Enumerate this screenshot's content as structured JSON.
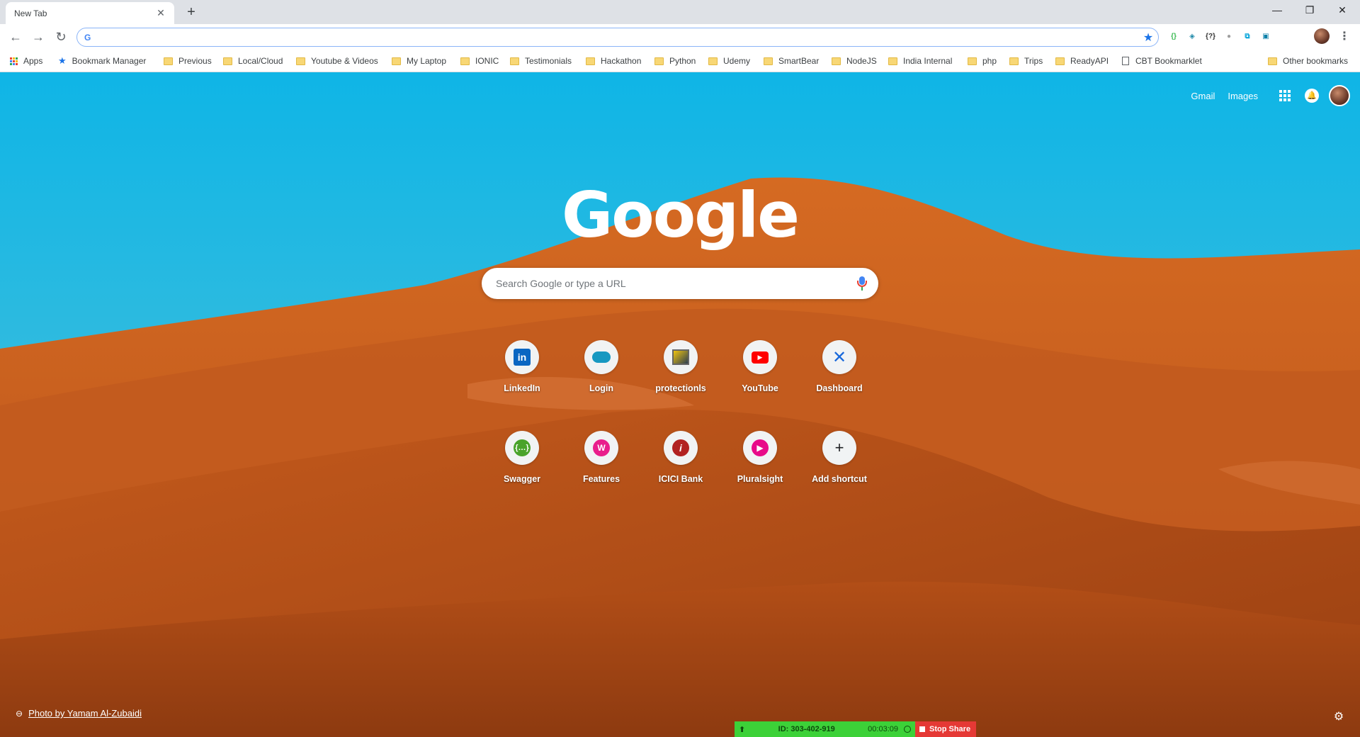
{
  "tab": {
    "title": "New Tab",
    "close": "✕",
    "new_tab": "+"
  },
  "window": {
    "minimize": "—",
    "restore": "❐",
    "close": "✕"
  },
  "toolbar": {
    "back": "←",
    "forward": "→",
    "reload": "↻",
    "omnibox_value": "",
    "omnibox_icon": "G"
  },
  "extensions": [
    {
      "icon": "json-viewer-icon",
      "glyph": "{}",
      "color": "#3cba54"
    },
    {
      "icon": "extension-teal-icon",
      "glyph": "◈",
      "color": "#1e88a8"
    },
    {
      "icon": "braces-question-icon",
      "glyph": "{?}",
      "color": "#333333"
    },
    {
      "icon": "circle-grey-icon",
      "glyph": "●",
      "color": "#9e9e9e"
    },
    {
      "icon": "capture-icon",
      "glyph": "⧉",
      "color": "#00a3d9"
    },
    {
      "icon": "screen-icon",
      "glyph": "▣",
      "color": "#0b7fa8"
    }
  ],
  "bookmarks": [
    {
      "label": "Apps",
      "type": "apps"
    },
    {
      "label": "Bookmark Manager",
      "type": "star"
    },
    {
      "label": "Previous",
      "type": "folder"
    },
    {
      "label": "Local/Cloud",
      "type": "folder"
    },
    {
      "label": "Youtube & Videos",
      "type": "folder"
    },
    {
      "label": "My Laptop",
      "type": "folder"
    },
    {
      "label": "IONIC",
      "type": "folder"
    },
    {
      "label": "Testimonials",
      "type": "folder"
    },
    {
      "label": "Hackathon",
      "type": "folder"
    },
    {
      "label": "Python",
      "type": "folder"
    },
    {
      "label": "Udemy",
      "type": "folder"
    },
    {
      "label": "SmartBear",
      "type": "folder"
    },
    {
      "label": "NodeJS",
      "type": "folder"
    },
    {
      "label": "India Internal",
      "type": "folder"
    },
    {
      "label": "php",
      "type": "folder"
    },
    {
      "label": "Trips",
      "type": "folder"
    },
    {
      "label": "ReadyAPI",
      "type": "folder"
    },
    {
      "label": "CBT Bookmarklet",
      "type": "page"
    }
  ],
  "other_bookmarks": "Other bookmarks",
  "ntp": {
    "gmail": "Gmail",
    "images": "Images",
    "logo": "Google",
    "search_placeholder": "Search Google or type a URL",
    "shortcuts": [
      {
        "label": "LinkedIn",
        "icon": "linkedin-icon",
        "glyph": "in"
      },
      {
        "label": "Login",
        "icon": "salesforce-cloud-icon",
        "glyph": ""
      },
      {
        "label": "protectionls",
        "icon": "image-thumbnail-icon",
        "glyph": ""
      },
      {
        "label": "YouTube",
        "icon": "youtube-icon",
        "glyph": "▶"
      },
      {
        "label": "Dashboard",
        "icon": "confluence-icon",
        "glyph": "✕"
      },
      {
        "label": "Swagger",
        "icon": "swagger-icon",
        "glyph": "{…}"
      },
      {
        "label": "Features",
        "icon": "wordpress-icon",
        "glyph": "W"
      },
      {
        "label": "ICICI Bank",
        "icon": "icici-icon",
        "glyph": "i"
      },
      {
        "label": "Pluralsight",
        "icon": "pluralsight-icon",
        "glyph": "▶"
      },
      {
        "label": "Add shortcut",
        "icon": "plus-icon",
        "glyph": "+"
      }
    ],
    "photo_credit": "Photo by Yamam Al-Zubaidi",
    "settings_icon": "⚙"
  },
  "share": {
    "id": "ID: 303-402-919",
    "time": "00:03:09",
    "stop": "Stop Share"
  },
  "colors": {
    "accent": "#1a73e8",
    "share_green": "#3cd138",
    "share_red": "#e53935"
  }
}
